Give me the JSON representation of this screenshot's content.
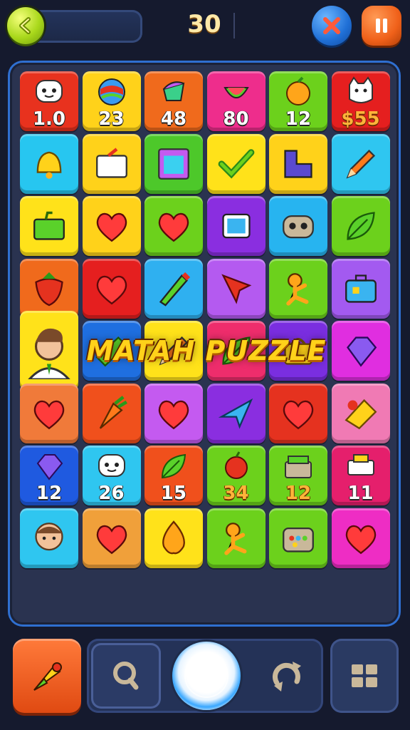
{
  "header": {
    "score": "30",
    "progress": 0.0,
    "back_icon": "chevron-left-icon",
    "close_icon": "close-icon",
    "pause_icon": "pause-icon"
  },
  "banner": {
    "title": "MATAH PUZZLE"
  },
  "board": {
    "columns": 6,
    "rows": [
      [
        {
          "icon": "face-icon",
          "color": "#e8321e",
          "num": "1.0"
        },
        {
          "icon": "ball-icon",
          "color": "#ffd21a",
          "num": "23"
        },
        {
          "icon": "cupcake-icon",
          "color": "#f06a1c",
          "num": "48"
        },
        {
          "icon": "watermelon-icon",
          "color": "#ee2d8c",
          "num": "80"
        },
        {
          "icon": "orange-icon",
          "color": "#6cd11c",
          "num": "12"
        },
        {
          "icon": "cat-icon",
          "color": "#e51f1f",
          "num": "$55",
          "gold": true
        }
      ],
      [
        {
          "icon": "bell-icon",
          "color": "#27c6f0"
        },
        {
          "icon": "gift-box-icon",
          "color": "#ffd21a"
        },
        {
          "icon": "frame-icon",
          "color": "#4dc82a"
        },
        {
          "icon": "checkmark-icon",
          "color": "#ffe21a"
        },
        {
          "icon": "block-icon",
          "color": "#ffd21a"
        },
        {
          "icon": "pencil-icon",
          "color": "#2fc6f0"
        }
      ],
      [
        {
          "icon": "bag-icon",
          "color": "#ffe21a"
        },
        {
          "icon": "heart-icon",
          "color": "#ffd21a"
        },
        {
          "icon": "heart-icon",
          "color": "#6cd11c"
        },
        {
          "icon": "monitor-icon",
          "color": "#8a2ee0"
        },
        {
          "icon": "robot-icon",
          "color": "#27b4f0"
        },
        {
          "icon": "leaf-icon",
          "color": "#6cd11c"
        }
      ],
      [
        {
          "icon": "strawberry-icon",
          "color": "#f06a1c"
        },
        {
          "icon": "heart-icon",
          "color": "#e51f1f"
        },
        {
          "icon": "marker-icon",
          "color": "#2fb0f0"
        },
        {
          "icon": "arrow-icon",
          "color": "#b45af0"
        },
        {
          "icon": "stick-figure-icon",
          "color": "#6cd11c"
        },
        {
          "icon": "briefcase-icon",
          "color": "#a35af0"
        }
      ],
      [
        {
          "icon": "boy-avatar-icon",
          "color": "#ffe21a",
          "big": true
        },
        {
          "icon": "candy-icon",
          "color": "#1f6fe0"
        },
        {
          "icon": "pencil-icon",
          "color": "#ffe21a"
        },
        {
          "icon": "leaf-icon",
          "color": "#ee2d6c"
        },
        {
          "icon": "handbag-icon",
          "color": "#7a2ee0"
        },
        {
          "icon": "gem-icon",
          "color": "#e02ee0"
        }
      ],
      [
        {
          "icon": "heart-icon",
          "color": "#f07a3a"
        },
        {
          "icon": "carrot-icon",
          "color": "#f0501c"
        },
        {
          "icon": "heart-icon",
          "color": "#c45af0"
        },
        {
          "icon": "plane-icon",
          "color": "#8a2ee0"
        },
        {
          "icon": "heart-icon",
          "color": "#e5321f"
        },
        {
          "icon": "cake-icon",
          "color": "#f07ab4"
        }
      ],
      [
        {
          "icon": "gem-icon",
          "color": "#1f5ae0",
          "num": "12"
        },
        {
          "icon": "face-icon",
          "color": "#2fc6f0",
          "num": "26"
        },
        {
          "icon": "leaf-icon",
          "color": "#f0501c",
          "num": "15"
        },
        {
          "icon": "apple-icon",
          "color": "#6cd11c",
          "num": "34",
          "gold": true
        },
        {
          "icon": "shop-icon",
          "color": "#6cd11c",
          "num": "12",
          "gold": true
        },
        {
          "icon": "printer-icon",
          "color": "#e51f6c",
          "num": "11"
        }
      ],
      [
        {
          "icon": "man-avatar-icon",
          "color": "#2fc6f0"
        },
        {
          "icon": "heart-icon",
          "color": "#f0a03a"
        },
        {
          "icon": "flame-icon",
          "color": "#ffe21a"
        },
        {
          "icon": "stick-figure-icon",
          "color": "#6cd11c"
        },
        {
          "icon": "toolbox-icon",
          "color": "#6cd11c"
        },
        {
          "icon": "heart-icon",
          "color": "#ee2dc4"
        }
      ]
    ]
  },
  "bottom": {
    "rocket_icon": "rocket-icon",
    "hint_icon": "magnifier-icon",
    "center_icon": "orb-button-icon",
    "shuffle_icon": "shuffle-icon",
    "menu_icon": "grid-menu-icon"
  },
  "colors": {
    "background": "#151a2e",
    "board_border": "#2f6fd0",
    "banner_text": "#ffd21a"
  }
}
